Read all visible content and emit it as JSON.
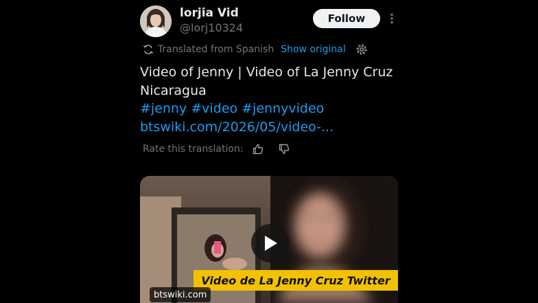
{
  "author": {
    "display_name": "lorjia Vid",
    "handle": "@lorj10324",
    "follow_label": "Follow"
  },
  "translation": {
    "translated_label": "Translated from Spanish",
    "show_original_label": "Show original"
  },
  "post": {
    "line1": "Video of Jenny | Video of La Jenny Cruz",
    "line2": "Nicaragua",
    "hashtags": [
      "#jenny",
      "#video",
      "#jennyvideo"
    ],
    "link": "btswiki.com/2026/05/video-..."
  },
  "rating": {
    "label": "Rate this translation:"
  },
  "media": {
    "caption": "Video de La Jenny Cruz Twitter",
    "source_label": "btswiki.com"
  },
  "icons": {
    "more": "more-vertical-icon",
    "translate": "translate-icon",
    "settings": "gear-icon",
    "thumbs_up": "thumbs-up-icon",
    "thumbs_down": "thumbs-down-icon",
    "play": "play-icon"
  },
  "colors": {
    "background": "#000000",
    "text": "#e7e9ea",
    "secondary_text": "#71767b",
    "link_blue": "#1d9bf0",
    "follow_bg": "#eff3f4",
    "caption_bg": "#f2c200"
  }
}
